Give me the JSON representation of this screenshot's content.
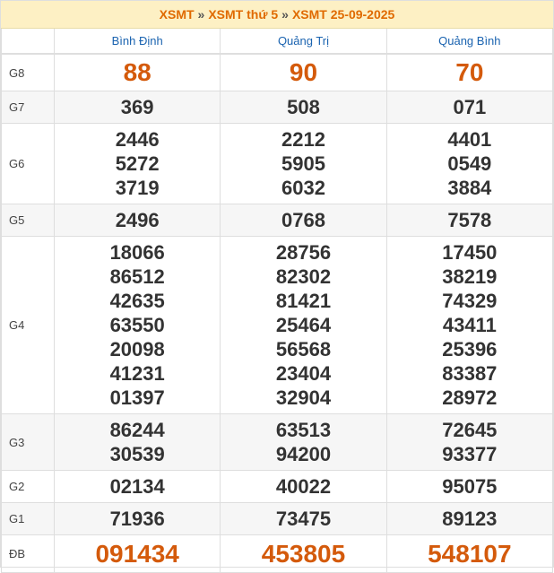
{
  "breadcrumb": {
    "item1": "XSMT",
    "sep1": "»",
    "item2": "XSMT thứ 5",
    "sep2": "»",
    "item3": "XSMT 25-09-2025"
  },
  "provinces": [
    "Bình Định",
    "Quảng Trị",
    "Quảng Bình"
  ],
  "rows": [
    {
      "label": "G8",
      "values": [
        [
          "88"
        ],
        [
          "90"
        ],
        [
          "70"
        ]
      ]
    },
    {
      "label": "G7",
      "values": [
        [
          "369"
        ],
        [
          "508"
        ],
        [
          "071"
        ]
      ]
    },
    {
      "label": "G6",
      "values": [
        [
          "2446",
          "5272",
          "3719"
        ],
        [
          "2212",
          "5905",
          "6032"
        ],
        [
          "4401",
          "0549",
          "3884"
        ]
      ]
    },
    {
      "label": "G5",
      "values": [
        [
          "2496"
        ],
        [
          "0768"
        ],
        [
          "7578"
        ]
      ]
    },
    {
      "label": "G4",
      "values": [
        [
          "18066",
          "86512",
          "42635",
          "63550",
          "20098",
          "41231",
          "01397"
        ],
        [
          "28756",
          "82302",
          "81421",
          "25464",
          "56568",
          "23404",
          "32904"
        ],
        [
          "17450",
          "38219",
          "74329",
          "43411",
          "25396",
          "83387",
          "28972"
        ]
      ]
    },
    {
      "label": "G3",
      "values": [
        [
          "86244",
          "30539"
        ],
        [
          "63513",
          "94200"
        ],
        [
          "72645",
          "93377"
        ]
      ]
    },
    {
      "label": "G2",
      "values": [
        [
          "02134"
        ],
        [
          "40022"
        ],
        [
          "95075"
        ]
      ]
    },
    {
      "label": "G1",
      "values": [
        [
          "71936"
        ],
        [
          "73475"
        ],
        [
          "89123"
        ]
      ]
    },
    {
      "label": "ĐB",
      "values": [
        [
          "091434"
        ],
        [
          "453805"
        ],
        [
          "548107"
        ]
      ]
    }
  ]
}
